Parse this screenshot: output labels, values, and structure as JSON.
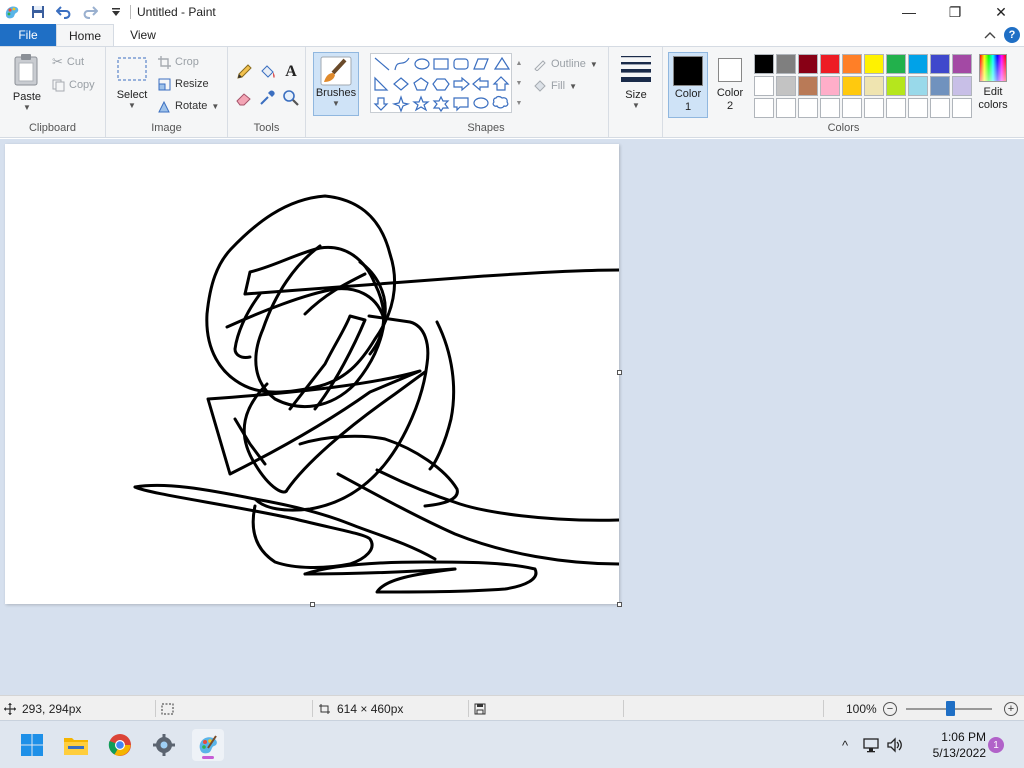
{
  "window": {
    "title": "Untitled - Paint",
    "minimize_glyph": "—",
    "maximize_glyph": "❐",
    "close_glyph": "✕"
  },
  "tabs": {
    "file": "File",
    "home": "Home",
    "view": "View",
    "help_glyph": "?"
  },
  "ribbon": {
    "clipboard": {
      "label": "Clipboard",
      "paste": "Paste",
      "cut": "Cut",
      "copy": "Copy"
    },
    "image": {
      "label": "Image",
      "select": "Select",
      "crop": "Crop",
      "resize": "Resize",
      "rotate": "Rotate"
    },
    "tools": {
      "label": "Tools",
      "text_glyph": "A"
    },
    "brushes": {
      "label": "Brushes"
    },
    "shapes": {
      "label": "Shapes",
      "outline": "Outline",
      "fill": "Fill"
    },
    "size": {
      "label": "Size"
    },
    "colors": {
      "label": "Colors",
      "color1_line1": "Color",
      "color1_line2": "1",
      "color2_line1": "Color",
      "color2_line2": "2",
      "color1_value": "#000000",
      "color2_value": "#ffffff",
      "edit_line1": "Edit",
      "edit_line2": "colors",
      "palette": [
        "#000000",
        "#7f7f7f",
        "#880015",
        "#ed1c24",
        "#ff7f27",
        "#fff200",
        "#22b14c",
        "#00a2e8",
        "#3f48cc",
        "#a349a4",
        "#ffffff",
        "#c3c3c3",
        "#b97a57",
        "#ffaec9",
        "#ffc90e",
        "#efe4b0",
        "#b5e61d",
        "#99d9ea",
        "#7092be",
        "#c8bfe7",
        "#ffffff",
        "#ffffff",
        "#ffffff",
        "#ffffff",
        "#ffffff",
        "#ffffff",
        "#ffffff",
        "#ffffff",
        "#ffffff",
        "#ffffff"
      ]
    }
  },
  "status": {
    "cursor_pos": "293, 294px",
    "canvas_size": "614 × 460px",
    "zoom": "100%",
    "zoom_out_glyph": "−",
    "zoom_in_glyph": "+"
  },
  "taskbar": {
    "time": "1:06 PM",
    "date": "5/13/2022",
    "notifications": "1",
    "tray_chevron": "^"
  }
}
